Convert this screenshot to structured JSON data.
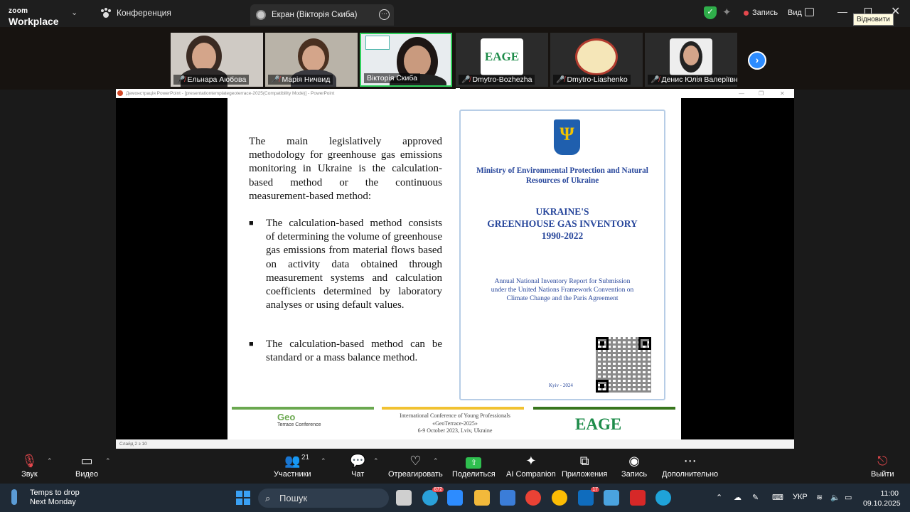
{
  "app": {
    "logo_top": "zoom",
    "logo_bottom": "Workplace",
    "conference_label": "Конференция",
    "screen_tab": "Екран (Вікторія Скиба)"
  },
  "topbar": {
    "record_label": "Запись",
    "view_label": "Вид",
    "restore_tooltip": "Відновити"
  },
  "participants": [
    {
      "name": "Ельнара Аюбова",
      "muted": true
    },
    {
      "name": "Марія Ничвид",
      "muted": true
    },
    {
      "name": "Вікторія Скиба",
      "muted": false,
      "active": true
    },
    {
      "name": "Dmytro-Bozhezha",
      "muted": true,
      "logo": "EAGE"
    },
    {
      "name": "Dmytro-Liashenko",
      "muted": true
    },
    {
      "name": "Денис Юлія Валеріївна",
      "muted": true
    }
  ],
  "ppt": {
    "window_title": "Демонстрація PowerPoint - [presentationtemplategeoterrace-2025(Compatibility Mode)] - PowerPoint",
    "status": "Слайд 2 з 10"
  },
  "slide": {
    "intro": "The main legislatively approved methodology for greenhouse gas emissions monitoring in Ukraine is the calculation-based method or the continuous measurement-based method:",
    "bullets": [
      "The calculation-based method consists of determining the volume of greenhouse gas emissions from material flows based on activity data obtained through measurement systems and calculation coefficients determined by laboratory analyses or using default values.",
      "The calculation-based method can be standard or a mass balance method."
    ],
    "doc": {
      "ministry": "Ministry of Environmental Protection and Natural Resources of Ukraine",
      "title_1": "UKRAINE'S",
      "title_2": "GREENHOUSE GAS INVENTORY",
      "title_3": "1990-2022",
      "report": "Annual National Inventory Report for Submission under the United Nations Framework Convention on Climate Change and the Paris Agreement",
      "place": "Kyiv - 2024"
    },
    "footer": {
      "geo_logo": "Geo",
      "geo_sub": "Terrace Conference",
      "line1": "International Conference of Young Professionals",
      "line2": "«GeoTerrace-2025»",
      "line3": "6-9 October 2023, Lviv, Ukraine",
      "eage": "EAGE"
    }
  },
  "controls": {
    "audio": "Звук",
    "video": "Видео",
    "participants": "Участники",
    "participants_count": "21",
    "chat": "Чат",
    "react": "Отреагировать",
    "share": "Поделиться",
    "ai": "AI Companion",
    "apps": "Приложения",
    "record": "Запись",
    "more": "Дополнительно",
    "leave": "Выйти"
  },
  "taskbar": {
    "weather_1": "Temps to drop",
    "weather_2": "Next Monday",
    "search": "Пошук",
    "telegram_badge": "672",
    "outlook_badge": "17",
    "lang": "УКР",
    "time": "11:00",
    "date": "09.10.2025"
  }
}
